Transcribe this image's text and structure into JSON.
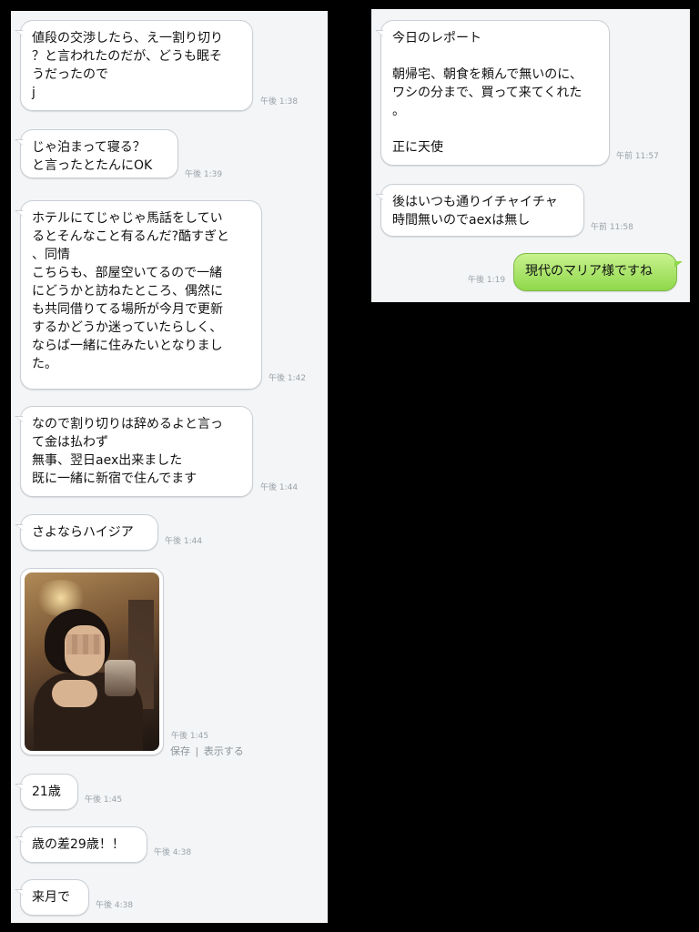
{
  "left_chat": [
    {
      "text": "値段の交渉したら、え一割り切り\n？と言われたのだが、どうも眠そ\nうだったので\nj",
      "time": "午後 1:38"
    },
    {
      "text": "じゃ泊まって寝る？\nと言ったとたんにOK",
      "time": "午後 1:39"
    },
    {
      "text": "ホテルにてじゃじゃ馬話をしてい\nるとそんなこと有るんだ?酷すぎと\n、同情\nこちらも、部屋空いてるので一緒\nにどうかと訪ねたところ、偶然に\nも共同借りてる場所が今月で更新\nするかどうか迷っていたらしく、\nならば一緒に住みたいとなりまし\nた。",
      "time": "午後 1:42"
    },
    {
      "text": "なので割り切りは辞めるよと言っ\nて金は払わず\n無事、翌日aex出来ました\n既に一緒に新宿で住んでます",
      "time": "午後 1:44"
    },
    {
      "text": "さよならハイジア",
      "time": "午後 1:44"
    },
    {
      "text": "21歳",
      "time": "午後 1:45"
    },
    {
      "text": "歳の差29歳！！",
      "time": "午後 4:38"
    },
    {
      "text": "来月で",
      "time": "午後 4:38"
    }
  ],
  "image_message": {
    "time": "午後 1:45",
    "save_label": "保存",
    "separator": "|",
    "view_label": "表示する"
  },
  "right_chat": [
    {
      "text": "今日のレポート\n\n朝帰宅、朝食を頼んで無いのに、\nワシの分まで、買って来てくれた\n。\n\n正に天使",
      "time": "午前 11:57"
    },
    {
      "text": "後はいつも通りイチャイチャ\n時間無いのでaexは無し",
      "time": "午前 11:58"
    }
  ],
  "sent_message": {
    "text": "現代のマリア様ですね",
    "time": "午後 1:19"
  },
  "colors": {
    "sent_bubble": "#9edb5a",
    "background": "#f3f5f7",
    "timestamp": "#9aa2a8"
  }
}
